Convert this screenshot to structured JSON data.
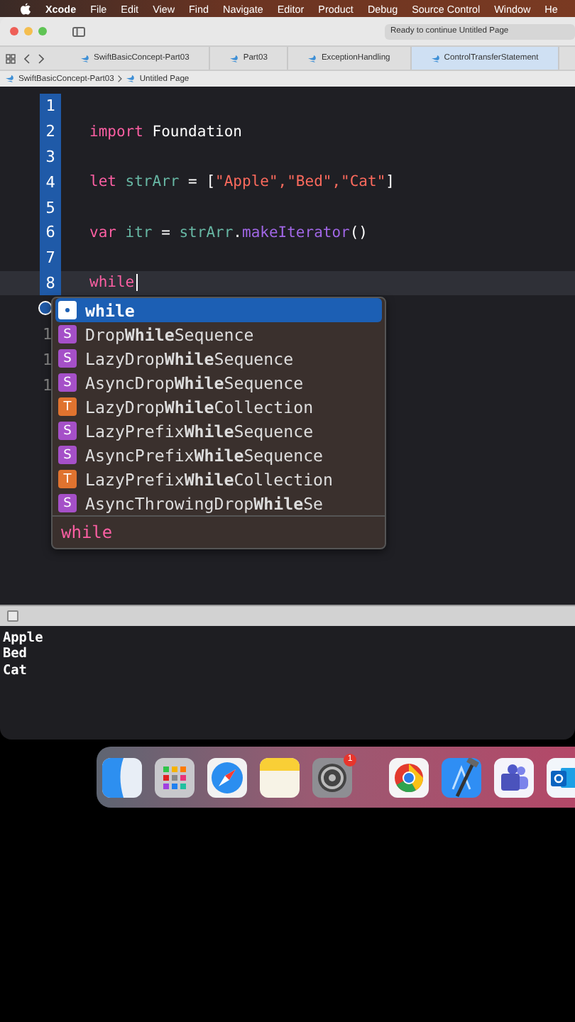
{
  "menu_bar": {
    "app": "Xcode",
    "items": [
      "File",
      "Edit",
      "View",
      "Find",
      "Navigate",
      "Editor",
      "Product",
      "Debug",
      "Source Control",
      "Window",
      "He"
    ]
  },
  "toolbar": {
    "status": "Ready to continue Untitled Page"
  },
  "tabs": [
    {
      "label": "SwiftBasicConcept-Part03",
      "selected": false
    },
    {
      "label": "Part03",
      "selected": false
    },
    {
      "label": "ExceptionHandling",
      "selected": false
    },
    {
      "label": "ControlTransferStatement",
      "selected": true
    }
  ],
  "jump_bar": [
    "SwiftBasicConcept-Part03",
    "Untitled Page"
  ],
  "editor": {
    "lines": [
      {
        "number": "1"
      },
      {
        "number": "2",
        "tokens": [
          {
            "kind": "keyword",
            "text": "import"
          },
          {
            "kind": "plain",
            "text": " Foundation"
          }
        ]
      },
      {
        "number": "3"
      },
      {
        "number": "4",
        "tokens": [
          {
            "kind": "keyword",
            "text": "let"
          },
          {
            "kind": "identifier",
            "text": " strArr"
          },
          {
            "kind": "plain",
            "text": " = ["
          },
          {
            "kind": "string",
            "text": "\"Apple\",\"Bed\",\"Cat\""
          },
          {
            "kind": "plain",
            "text": "]"
          }
        ]
      },
      {
        "number": "5"
      },
      {
        "number": "6",
        "tokens": [
          {
            "kind": "keyword",
            "text": "var"
          },
          {
            "kind": "identifier",
            "text": " itr"
          },
          {
            "kind": "plain",
            "text": " = "
          },
          {
            "kind": "identifier",
            "text": "strArr"
          },
          {
            "kind": "plain",
            "text": "."
          },
          {
            "kind": "method",
            "text": "makeIterator"
          },
          {
            "kind": "plain",
            "text": "()"
          }
        ]
      },
      {
        "number": "7",
        "current": false
      },
      {
        "number": "8",
        "current": true,
        "tokens": [
          {
            "kind": "keyword",
            "text": "while"
          }
        ]
      }
    ],
    "hidden_line_numbers": [
      "1",
      "1",
      "1"
    ]
  },
  "completions": {
    "items": [
      {
        "kind": "keyword",
        "label": "while",
        "selected": true
      },
      {
        "kind": "struct",
        "icon": "S",
        "label": "Drop**While**Sequence",
        "selected": false
      },
      {
        "kind": "struct",
        "icon": "S",
        "label": "LazyDrop**While**Sequence",
        "selected": false
      },
      {
        "kind": "struct",
        "icon": "S",
        "label": "AsyncDrop**While**Sequence",
        "selected": false
      },
      {
        "kind": "typealias",
        "icon": "T",
        "label": "LazyDrop**While**Collection",
        "selected": false
      },
      {
        "kind": "struct",
        "icon": "S",
        "label": "LazyPrefix**While**Sequence",
        "selected": false
      },
      {
        "kind": "struct",
        "icon": "S",
        "label": "AsyncPrefix**While**Sequence",
        "selected": false
      },
      {
        "kind": "typealias",
        "icon": "T",
        "label": "LazyPrefix**While**Collection",
        "selected": false
      },
      {
        "kind": "struct",
        "icon": "S",
        "label": "AsyncThrowingDrop**While**Se",
        "selected": false
      }
    ],
    "footer": "while"
  },
  "console": {
    "filter_checked": false,
    "lines": [
      "Apple",
      "Bed",
      "Cat"
    ]
  },
  "dock": {
    "apps": [
      {
        "kind": "finder"
      },
      {
        "kind": "launchpad"
      },
      {
        "kind": "safari"
      },
      {
        "kind": "notes"
      },
      {
        "kind": "settings",
        "badge": "1"
      },
      {
        "kind": "divider"
      },
      {
        "kind": "chrome"
      },
      {
        "kind": "xcode"
      },
      {
        "kind": "teams"
      },
      {
        "kind": "outlook"
      }
    ]
  }
}
